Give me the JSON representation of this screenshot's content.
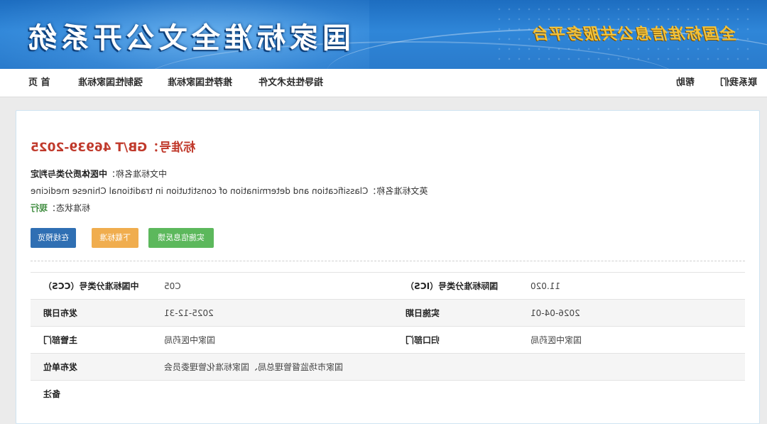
{
  "header": {
    "site_title": "国家标准全文公开系统",
    "slogan": "全国标准信息公共服务平台"
  },
  "nav": {
    "items": [
      {
        "label": "首 页"
      },
      {
        "label": "强制性国家标准"
      },
      {
        "label": "推荐性国家标准"
      },
      {
        "label": "指导性技术文件"
      }
    ],
    "help": "帮助",
    "contact": "联系我们"
  },
  "standard": {
    "number_label": "标准号：",
    "number": "GB/T 46939-2025",
    "cn_name_label": "中文标准名称：",
    "cn_name": "中医体质分类与判定",
    "en_name_label": "英文标准名称：",
    "en_name": "Classification and determination of constitution in traditional Chinese medicine",
    "status_label": "标准状态：",
    "status": "现行"
  },
  "buttons": {
    "preview": "在线预览",
    "download": "下载标准",
    "feedback": "实施信息反馈"
  },
  "details": {
    "ccs_label": "中国标准分类号（CCS）",
    "ccs_value": "C05",
    "ics_label": "国际标准分类号（ICS）",
    "ics_value": "11.020",
    "publish_date_label": "发布日期",
    "publish_date": "2025-12-31",
    "impl_date_label": "实施日期",
    "impl_date": "2026-04-01",
    "dept_label": "主管部门",
    "dept_value": "国家中医药局",
    "central_dept_label": "归口部门",
    "central_dept_value": "国家中医药局",
    "publisher_label": "发布单位",
    "publisher_value": "国家市场监督管理总局、国家标准化管理委员会",
    "remark_label": "备注",
    "remark_value": ""
  },
  "colors": {
    "banner": "#2a7bcc",
    "title_red": "#c0392b",
    "status_green": "#3d8b3d",
    "btn_blue": "#2f6fb3",
    "btn_orange": "#f0ad4e",
    "btn_green": "#5cb85c"
  }
}
